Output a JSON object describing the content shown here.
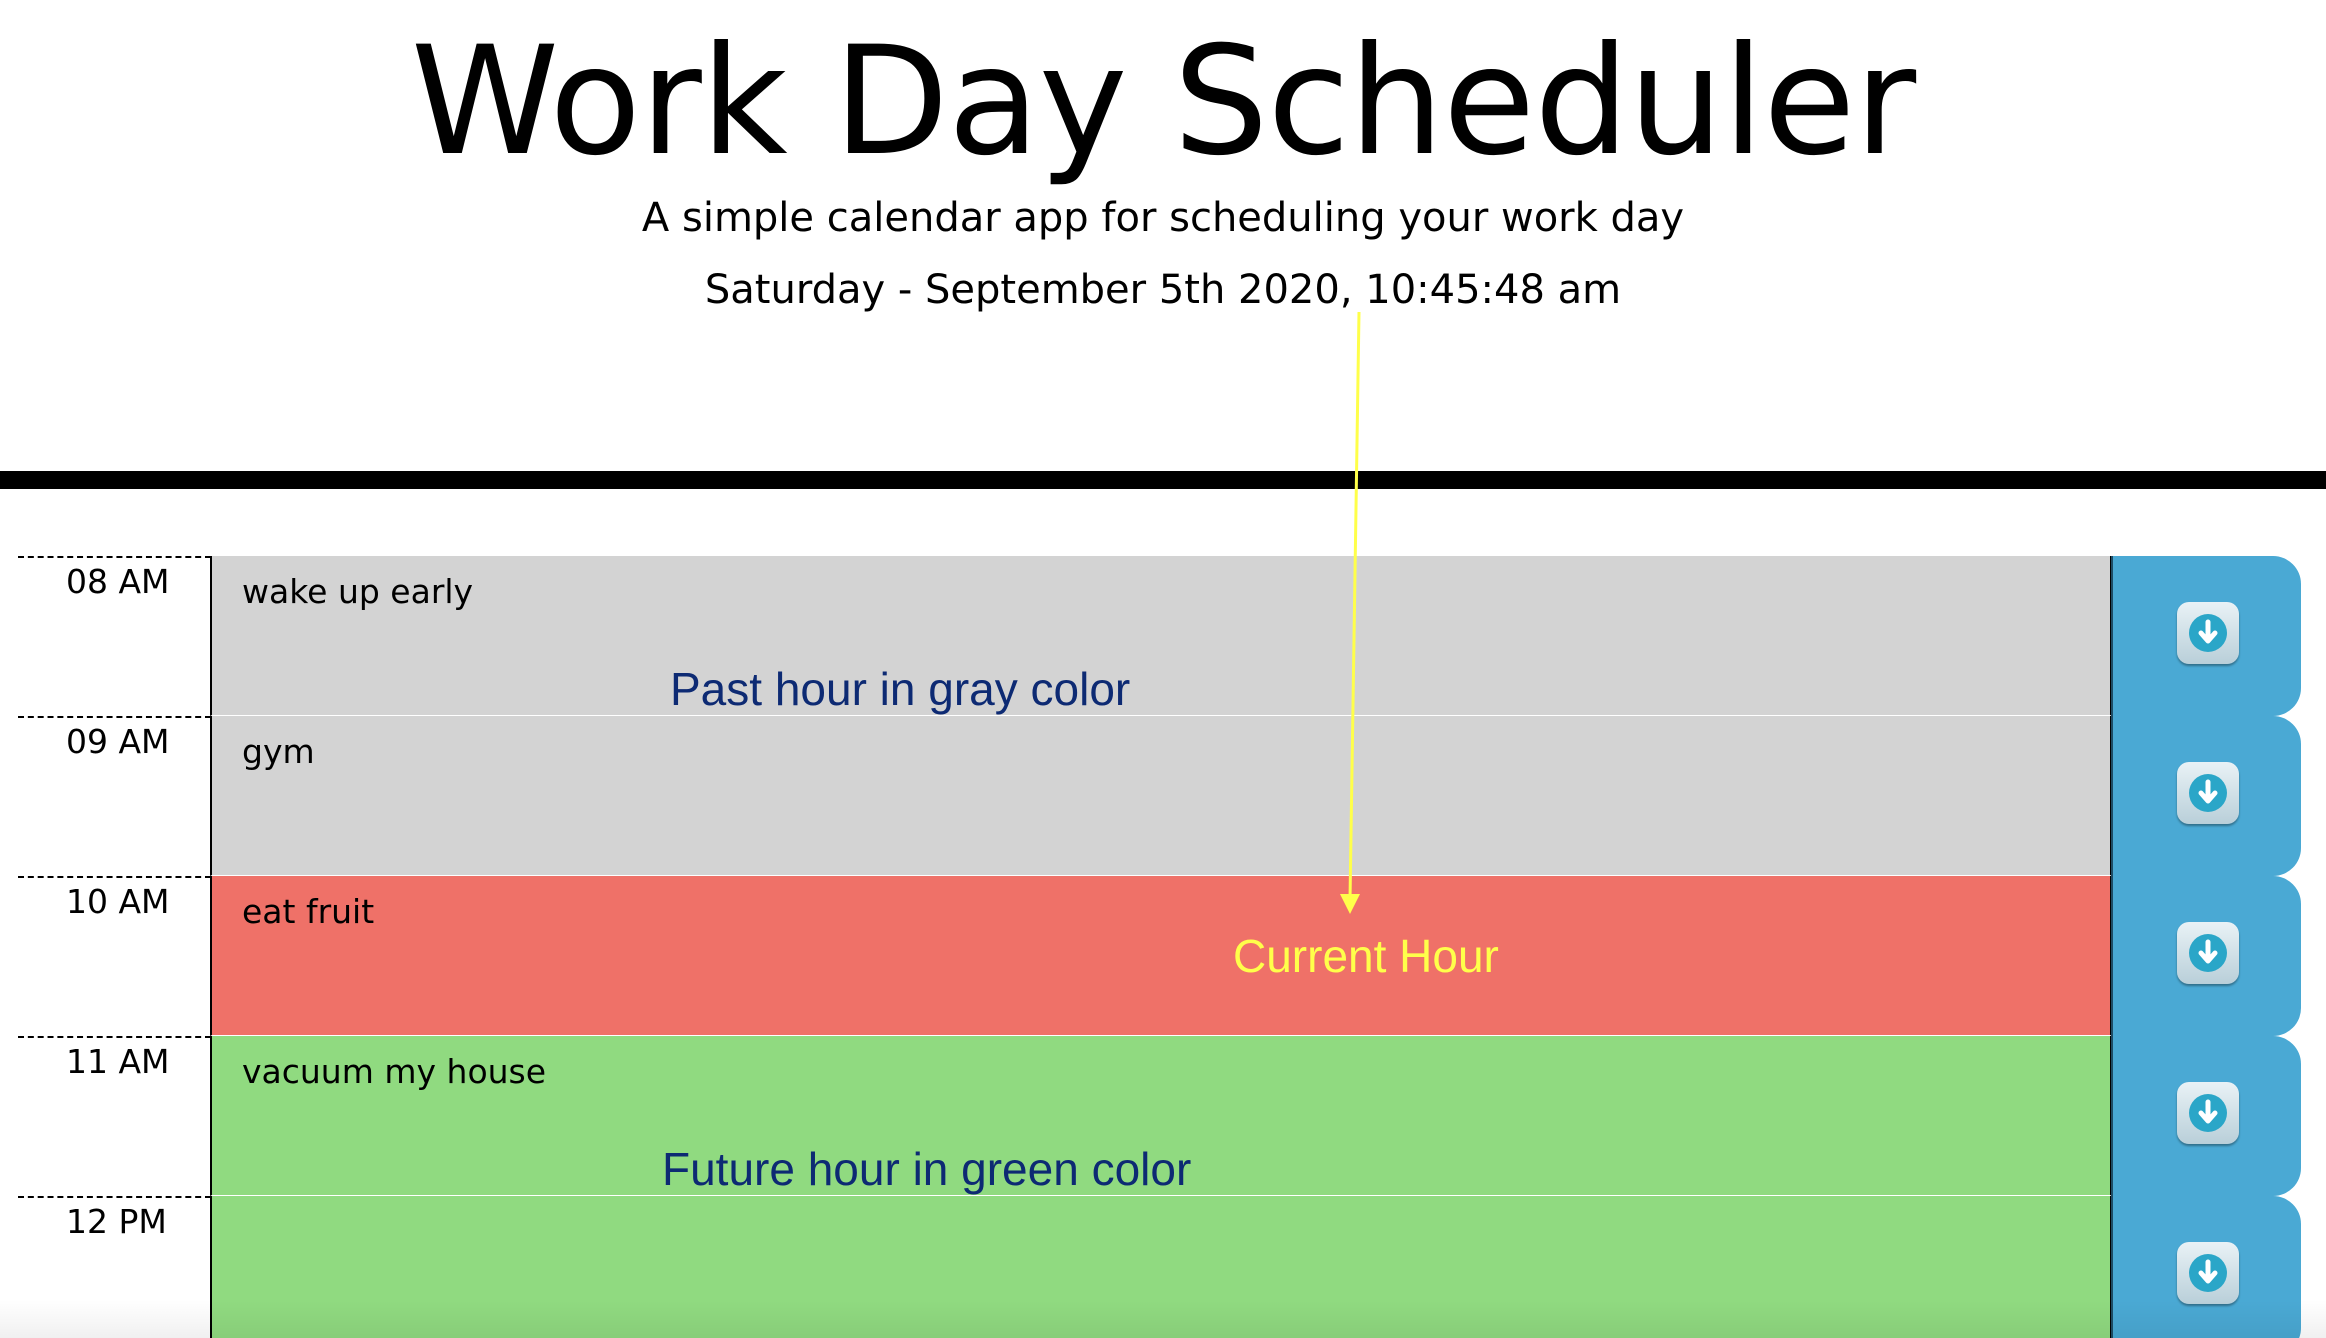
{
  "header": {
    "title": "Work Day Scheduler",
    "subtitle": "A simple calendar app for scheduling your work day",
    "current_day": "Saturday - September 5th 2020, 10:45:48 am"
  },
  "rows": [
    {
      "hour": "08 AM",
      "text": "wake up early",
      "state": "past"
    },
    {
      "hour": "09 AM",
      "text": "gym",
      "state": "past"
    },
    {
      "hour": "10 AM",
      "text": "eat fruit",
      "state": "present"
    },
    {
      "hour": "11 AM",
      "text": "vacuum my house",
      "state": "future"
    },
    {
      "hour": "12 PM",
      "text": "",
      "state": "future"
    }
  ],
  "annotations": {
    "past": "Past hour in gray color",
    "current": "Current Hour",
    "future": "Future hour in green color"
  },
  "colors": {
    "past": "#d3d3d3",
    "present": "#ef7168",
    "future": "#90da80",
    "save_button": "#4aa9d4",
    "annotation_blue": "#0d2a73",
    "annotation_yellow": "#ffff4a"
  },
  "icons": {
    "save": "save-icon"
  }
}
